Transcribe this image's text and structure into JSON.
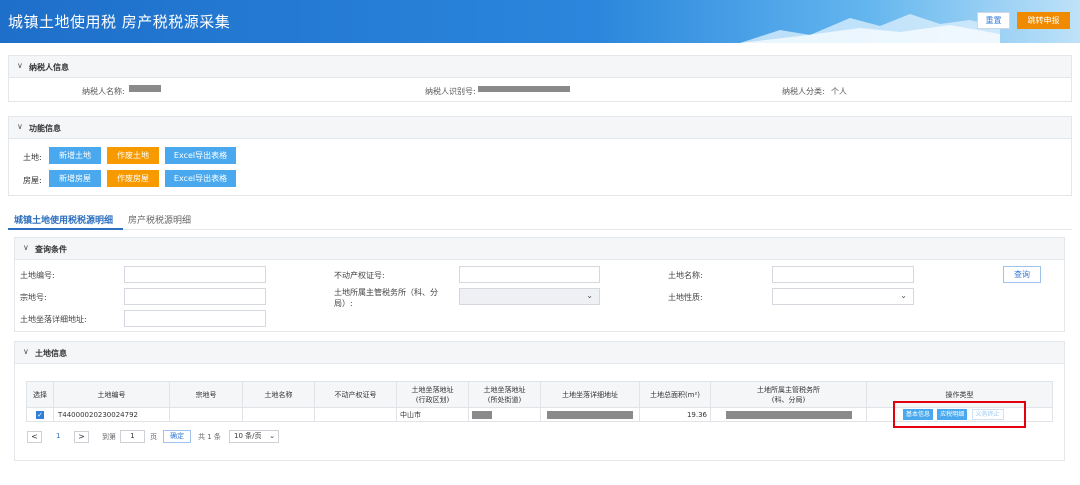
{
  "header": {
    "title": "城镇土地使用税 房产税税源采集",
    "reset_label": "重置",
    "submit_label": "跳转申报"
  },
  "taxpayer": {
    "section_title": "纳税人信息",
    "name_label": "纳税人名称:",
    "id_label": "纳税人识别号:",
    "category_label": "纳税人分类:",
    "category_value": "个人"
  },
  "functions": {
    "section_title": "功能信息",
    "land_label": "土地:",
    "house_label": "房屋:",
    "land_buttons": [
      "新增土地",
      "作废土地",
      "Excel导出表格"
    ],
    "house_buttons": [
      "新增房屋",
      "作废房屋",
      "Excel导出表格"
    ]
  },
  "tabs": [
    "城镇土地使用税税源明细",
    "房产税税源明细"
  ],
  "query": {
    "section_title": "查询条件",
    "land_no_label": "土地编号:",
    "parcel_no_label": "宗地号:",
    "address_label": "土地坐落详细地址:",
    "cert_label": "不动产权证号:",
    "office_label": "土地所属主管税务所（科、分局）:",
    "land_name_label": "土地名称:",
    "land_nature_label": "土地性质:",
    "query_button": "查询"
  },
  "land_info": {
    "section_title": "土地信息",
    "columns": [
      "选择",
      "土地编号",
      "宗地号",
      "土地名称",
      "不动产权证号",
      "土地坐落地址\n(行政区划)",
      "土地坐落地址\n(所处街道)",
      "土地坐落详细地址",
      "土地总面积(m²)",
      "土地所属主管税务所\n(科、分局)",
      "操作类型"
    ],
    "rows": [
      {
        "land_no": "T44000020230024792",
        "parcel_no": "",
        "land_name": "",
        "cert_no": "",
        "district": "中山市",
        "area": "19.36",
        "actions": [
          "基本信息",
          "应税明细",
          "义务终止"
        ]
      }
    ]
  },
  "pagination": {
    "current_page": "1",
    "goto_label": "到第",
    "goto_value": "1",
    "page_unit": "页",
    "confirm_label": "确定",
    "total_label": "共 1 条",
    "page_size": "10 条/页"
  }
}
